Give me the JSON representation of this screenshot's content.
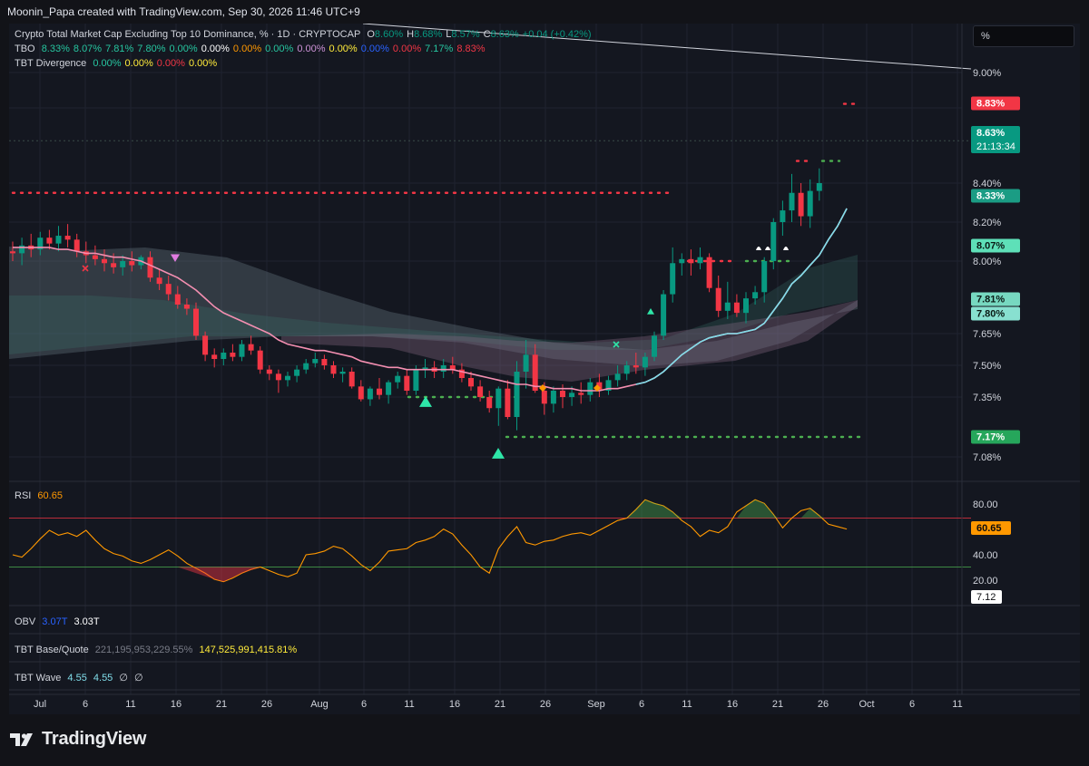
{
  "header": {
    "credit": "Moonin_Papa created with TradingView.com, Sep 30, 2026 11:46 UTC+9"
  },
  "legend": {
    "title": "Crypto Total Market Cap Excluding Top 10 Dominance, % · 1D · CRYPTOCAP",
    "ohlc": [
      {
        "k": "O",
        "v": "8.60%"
      },
      {
        "k": "H",
        "v": "8.68%"
      },
      {
        "k": "L",
        "v": "8.57%"
      },
      {
        "k": "C",
        "v": "8.63%"
      },
      {
        "k": "",
        "v": "+0.04 (+0.42%)"
      }
    ],
    "tbo_name": "TBO",
    "tbo_values": [
      {
        "v": "8.33%",
        "c": "#26c6a0"
      },
      {
        "v": "8.07%",
        "c": "#26c6a0"
      },
      {
        "v": "7.81%",
        "c": "#26c6a0"
      },
      {
        "v": "7.80%",
        "c": "#26c6a0"
      },
      {
        "v": "0.00%",
        "c": "#26c6a0"
      },
      {
        "v": "0.00%",
        "c": "#ffffff"
      },
      {
        "v": "0.00%",
        "c": "#ff9800"
      },
      {
        "v": "0.00%",
        "c": "#26c6a0"
      },
      {
        "v": "0.00%",
        "c": "#ce93d8"
      },
      {
        "v": "0.00%",
        "c": "#ffeb3b"
      },
      {
        "v": "0.00%",
        "c": "#2962ff"
      },
      {
        "v": "0.00%",
        "c": "#f23645"
      },
      {
        "v": "7.17%",
        "c": "#26c6a0"
      },
      {
        "v": "8.83%",
        "c": "#f23645"
      }
    ],
    "div_name": "TBT Divergence",
    "div_values": [
      {
        "v": "0.00%",
        "c": "#26c6a0"
      },
      {
        "v": "0.00%",
        "c": "#ffeb3b"
      },
      {
        "v": "0.00%",
        "c": "#f23645"
      },
      {
        "v": "0.00%",
        "c": "#ffeb3b"
      }
    ]
  },
  "unit_selector": "%",
  "price_axis": {
    "ticks": [
      "9.00%",
      "8.40%",
      "8.20%",
      "8.00%",
      "7.65%",
      "7.50%",
      "7.35%",
      "7.08%"
    ],
    "labels": [
      {
        "text": "8.83%",
        "color": "#f23645"
      },
      {
        "text": "8.63%",
        "sub": "21:13:34",
        "color": "#089981"
      },
      {
        "text": "8.33%",
        "color": "#1b9c84"
      },
      {
        "text": "8.07%",
        "color": "#5ee0b8"
      },
      {
        "text": "7.81%",
        "color": "#77d8c0"
      },
      {
        "text": "7.80%",
        "color": "#88e0d0"
      },
      {
        "text": "7.17%",
        "color": "#26a65b"
      }
    ]
  },
  "rsi": {
    "name": "RSI",
    "value": "60.65",
    "ticks": [
      "80.00",
      "40.00",
      "20.00"
    ],
    "extra_label": "7.12"
  },
  "obv": {
    "name": "OBV",
    "v1": "3.07T",
    "v2": "3.03T"
  },
  "tbt_bq": {
    "name": "TBT Base/Quote",
    "v1": "221,195,953,229.55%",
    "v2": "147,525,991,415.81%"
  },
  "tbt_wave": {
    "name": "TBT Wave",
    "v1": "4.55",
    "v2": "4.55",
    "v3": "∅",
    "v4": "∅"
  },
  "time_axis": [
    "Jul",
    "6",
    "11",
    "16",
    "21",
    "26",
    "Aug",
    "6",
    "11",
    "16",
    "21",
    "26",
    "Sep",
    "6",
    "11",
    "16",
    "21",
    "26",
    "Oct",
    "6",
    "11"
  ],
  "brand": "TradingView",
  "colors": {
    "up": "#089981",
    "down": "#f23645",
    "bg": "#141720",
    "rsi": "#ff9800",
    "sma": "#f48fb1",
    "ema": "#80deea"
  },
  "chart_data": {
    "type": "candlestick",
    "symbol": "CRYPTOCAP",
    "timeframe": "1D",
    "x_range": [
      "Jul 1",
      "Oct 11"
    ],
    "y_range_pct": [
      7.0,
      9.08
    ],
    "dates": [
      "Jul 1",
      "Jul 2",
      "Jul 3",
      "Jul 4",
      "Jul 5",
      "Jul 6",
      "Jul 7",
      "Jul 8",
      "Jul 9",
      "Jul 10",
      "Jul 11",
      "Jul 12",
      "Jul 13",
      "Jul 14",
      "Jul 15",
      "Jul 16",
      "Jul 17",
      "Jul 18",
      "Jul 19",
      "Jul 20",
      "Jul 21",
      "Jul 22",
      "Jul 23",
      "Jul 24",
      "Jul 25",
      "Jul 26",
      "Jul 27",
      "Jul 28",
      "Jul 29",
      "Jul 30",
      "Jul 31",
      "Aug 1",
      "Aug 2",
      "Aug 3",
      "Aug 4",
      "Aug 5",
      "Aug 6",
      "Aug 7",
      "Aug 8",
      "Aug 9",
      "Aug 10",
      "Aug 11",
      "Aug 12",
      "Aug 13",
      "Aug 14",
      "Aug 15",
      "Aug 16",
      "Aug 17",
      "Aug 18",
      "Aug 19",
      "Aug 20",
      "Aug 21",
      "Aug 22",
      "Aug 23",
      "Aug 24",
      "Aug 25",
      "Aug 26",
      "Aug 27",
      "Aug 28",
      "Aug 29",
      "Aug 30",
      "Aug 31",
      "Sep 1",
      "Sep 2",
      "Sep 3",
      "Sep 4",
      "Sep 5",
      "Sep 6",
      "Sep 7",
      "Sep 8",
      "Sep 9",
      "Sep 10",
      "Sep 11",
      "Sep 12",
      "Sep 13",
      "Sep 14",
      "Sep 15",
      "Sep 16",
      "Sep 17",
      "Sep 18",
      "Sep 19",
      "Sep 20",
      "Sep 21",
      "Sep 22",
      "Sep 23",
      "Sep 24",
      "Sep 25",
      "Sep 26",
      "Sep 27",
      "Sep 28",
      "Sep 29",
      "Sep 30"
    ],
    "ohlc": [
      [
        8.05,
        8.1,
        8.0,
        8.04
      ],
      [
        8.04,
        8.12,
        7.98,
        8.08
      ],
      [
        8.08,
        8.14,
        8.02,
        8.06
      ],
      [
        8.06,
        8.15,
        8.03,
        8.12
      ],
      [
        8.12,
        8.16,
        8.06,
        8.09
      ],
      [
        8.09,
        8.18,
        8.05,
        8.13
      ],
      [
        8.13,
        8.19,
        8.07,
        8.11
      ],
      [
        8.11,
        8.14,
        8.02,
        8.05
      ],
      [
        8.05,
        8.1,
        7.99,
        8.03
      ],
      [
        8.03,
        8.08,
        7.98,
        8.01
      ],
      [
        8.01,
        8.06,
        7.95,
        7.99
      ],
      [
        7.99,
        8.04,
        7.94,
        7.97
      ],
      [
        7.97,
        8.03,
        7.93,
        8.0
      ],
      [
        8.0,
        8.05,
        7.95,
        7.98
      ],
      [
        7.98,
        8.03,
        7.96,
        8.02
      ],
      [
        8.02,
        8.05,
        7.9,
        7.92
      ],
      [
        7.92,
        7.96,
        7.86,
        7.89
      ],
      [
        7.89,
        7.93,
        7.81,
        7.84
      ],
      [
        7.84,
        7.88,
        7.77,
        7.79
      ],
      [
        7.79,
        7.82,
        7.74,
        7.77
      ],
      [
        7.77,
        7.8,
        7.62,
        7.64
      ],
      [
        7.64,
        7.66,
        7.52,
        7.55
      ],
      [
        7.55,
        7.58,
        7.49,
        7.53
      ],
      [
        7.53,
        7.58,
        7.5,
        7.56
      ],
      [
        7.56,
        7.6,
        7.52,
        7.54
      ],
      [
        7.54,
        7.62,
        7.52,
        7.6
      ],
      [
        7.6,
        7.64,
        7.55,
        7.57
      ],
      [
        7.57,
        7.59,
        7.46,
        7.48
      ],
      [
        7.48,
        7.5,
        7.43,
        7.46
      ],
      [
        7.46,
        7.48,
        7.37,
        7.43
      ],
      [
        7.43,
        7.47,
        7.4,
        7.45
      ],
      [
        7.45,
        7.5,
        7.42,
        7.48
      ],
      [
        7.48,
        7.53,
        7.46,
        7.51
      ],
      [
        7.51,
        7.56,
        7.49,
        7.53
      ],
      [
        7.53,
        7.55,
        7.48,
        7.5
      ],
      [
        7.5,
        7.52,
        7.44,
        7.46
      ],
      [
        7.46,
        7.49,
        7.42,
        7.47
      ],
      [
        7.47,
        7.49,
        7.39,
        7.4
      ],
      [
        7.4,
        7.43,
        7.33,
        7.34
      ],
      [
        7.34,
        7.4,
        7.31,
        7.39
      ],
      [
        7.39,
        7.44,
        7.34,
        7.36
      ],
      [
        7.36,
        7.43,
        7.32,
        7.42
      ],
      [
        7.42,
        7.47,
        7.39,
        7.45
      ],
      [
        7.45,
        7.48,
        7.36,
        7.38
      ],
      [
        7.38,
        7.5,
        7.36,
        7.48
      ],
      [
        7.48,
        7.53,
        7.44,
        7.49
      ],
      [
        7.49,
        7.52,
        7.44,
        7.47
      ],
      [
        7.47,
        7.53,
        7.44,
        7.5
      ],
      [
        7.5,
        7.54,
        7.46,
        7.48
      ],
      [
        7.48,
        7.51,
        7.42,
        7.44
      ],
      [
        7.44,
        7.47,
        7.38,
        7.4
      ],
      [
        7.4,
        7.43,
        7.33,
        7.35
      ],
      [
        7.35,
        7.38,
        7.28,
        7.3
      ],
      [
        7.3,
        7.4,
        7.22,
        7.39
      ],
      [
        7.39,
        7.43,
        7.25,
        7.26
      ],
      [
        7.26,
        7.52,
        7.2,
        7.47
      ],
      [
        7.47,
        7.62,
        7.39,
        7.55
      ],
      [
        7.55,
        7.6,
        7.37,
        7.38
      ],
      [
        7.38,
        7.42,
        7.27,
        7.32
      ],
      [
        7.32,
        7.4,
        7.28,
        7.38
      ],
      [
        7.38,
        7.41,
        7.3,
        7.35
      ],
      [
        7.35,
        7.4,
        7.31,
        7.37
      ],
      [
        7.37,
        7.42,
        7.32,
        7.36
      ],
      [
        7.36,
        7.44,
        7.33,
        7.42
      ],
      [
        7.42,
        7.46,
        7.35,
        7.38
      ],
      [
        7.38,
        7.45,
        7.36,
        7.43
      ],
      [
        7.43,
        7.5,
        7.4,
        7.46
      ],
      [
        7.46,
        7.52,
        7.43,
        7.5
      ],
      [
        7.5,
        7.56,
        7.46,
        7.49
      ],
      [
        7.49,
        7.56,
        7.45,
        7.54
      ],
      [
        7.54,
        7.66,
        7.52,
        7.64
      ],
      [
        7.64,
        7.86,
        7.62,
        7.84
      ],
      [
        7.84,
        8.07,
        7.8,
        7.99
      ],
      [
        7.99,
        8.04,
        7.93,
        8.01
      ],
      [
        8.01,
        8.06,
        7.93,
        7.99
      ],
      [
        7.99,
        8.07,
        7.96,
        8.02
      ],
      [
        8.02,
        8.04,
        7.85,
        7.87
      ],
      [
        7.87,
        7.93,
        7.73,
        7.76
      ],
      [
        7.76,
        7.9,
        7.72,
        7.8
      ],
      [
        7.8,
        7.84,
        7.73,
        7.75
      ],
      [
        7.75,
        7.85,
        7.7,
        7.82
      ],
      [
        7.82,
        7.88,
        7.79,
        7.85
      ],
      [
        7.85,
        8.02,
        7.8,
        8.0
      ],
      [
        8.0,
        8.22,
        7.96,
        8.2
      ],
      [
        8.2,
        8.31,
        8.13,
        8.26
      ],
      [
        8.26,
        8.45,
        8.2,
        8.35
      ],
      [
        8.35,
        8.4,
        8.18,
        8.23
      ],
      [
        8.23,
        8.42,
        8.17,
        8.36
      ],
      [
        8.36,
        8.48,
        8.31,
        8.4
      ]
    ],
    "ema_fast": [
      8.07,
      8.07,
      8.07,
      8.07,
      8.07,
      8.06,
      8.06,
      8.05,
      8.04,
      8.04,
      8.03,
      8.02,
      8.02,
      8.01,
      8.0,
      7.98,
      7.96,
      7.94,
      7.92,
      7.89,
      7.86,
      7.82,
      7.78,
      7.75,
      7.73,
      7.71,
      7.69,
      7.67,
      7.65,
      7.62,
      7.6,
      7.59,
      7.58,
      7.57,
      7.57,
      7.56,
      7.55,
      7.54,
      7.52,
      7.51,
      7.5,
      7.49,
      7.49,
      7.48,
      7.48,
      7.48,
      7.48,
      7.48,
      7.48,
      7.47,
      7.46,
      7.45,
      7.44,
      7.43,
      7.42,
      7.41,
      7.41,
      7.4,
      7.4,
      7.39,
      7.39,
      7.39,
      7.38,
      7.38,
      7.38,
      7.39,
      7.39,
      7.4,
      7.41,
      7.42,
      7.44,
      7.47,
      7.51,
      7.55,
      7.58,
      7.61,
      7.63,
      7.64,
      7.65,
      7.65,
      7.66,
      7.67,
      7.7,
      7.76,
      7.82,
      7.89,
      7.93,
      7.98,
      8.03,
      8.11,
      8.18,
      8.27
    ],
    "tbo_levels": {
      "resistance": 8.35,
      "support_mid": 7.38,
      "support_low": 7.17,
      "aug_support": 7.35,
      "sep_level": 7.99,
      "late_level": 8.0,
      "top_level": 8.83
    }
  }
}
